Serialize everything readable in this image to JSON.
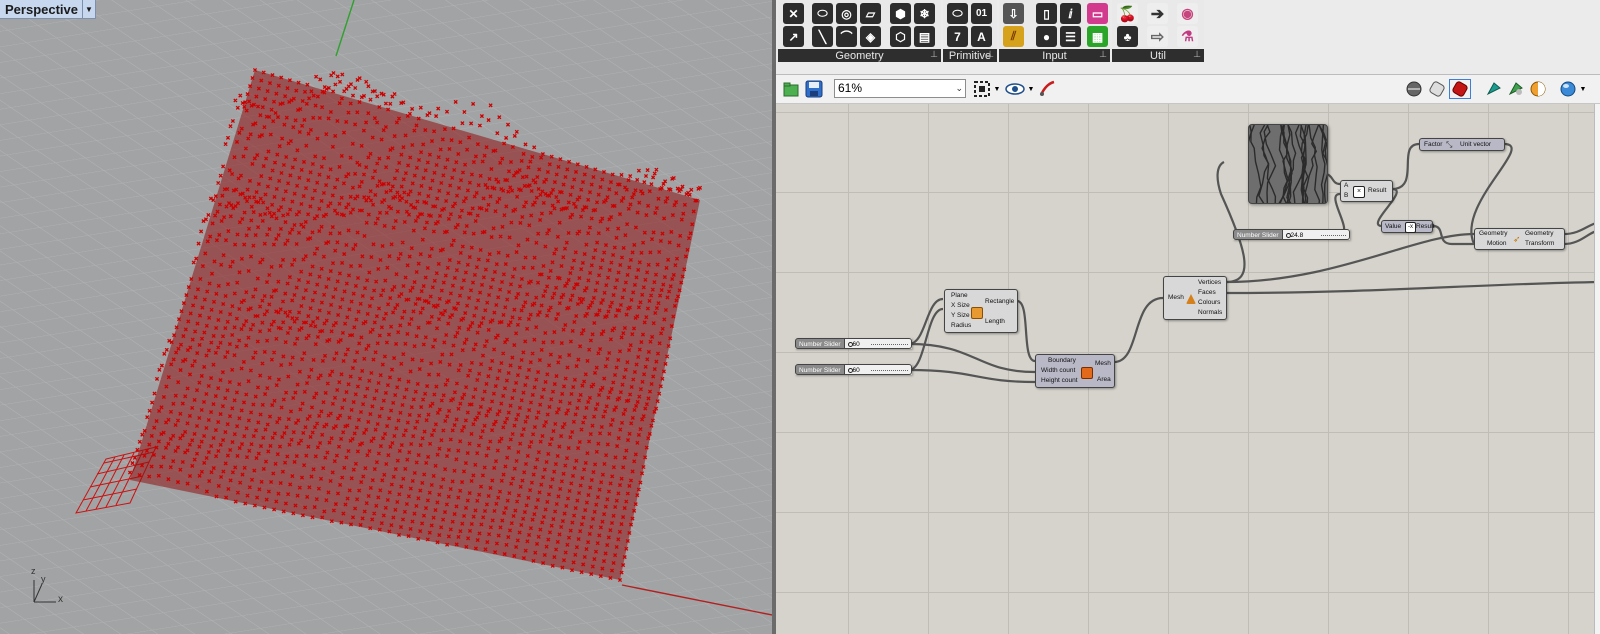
{
  "viewport": {
    "tab_label": "Perspective",
    "axis_x": "x",
    "axis_y": "y",
    "axis_z": "z"
  },
  "ribbon": {
    "panels": [
      {
        "label": "Geometry",
        "icons": [
          "point-icon",
          "circle-icon",
          "curve-icon",
          "surface-icon",
          "brep-icon",
          "mesh-icon",
          "vector-icon",
          "line-icon",
          "plane-icon",
          "twisted-box-icon",
          "field-icon",
          "geometry-pipeline-icon"
        ]
      },
      {
        "label": "Primitive",
        "icons": [
          "boolean-icon",
          "integer-icon",
          "number-icon",
          "text-icon"
        ]
      },
      {
        "label": "Input",
        "icons": [
          "data-input-icon",
          "panel-icon",
          "value-list-icon",
          "gradient-icon",
          "graph-mapper-icon",
          "toggle-icon",
          "button-icon",
          "colour-swatch-icon"
        ]
      },
      {
        "label": "Util",
        "icons": [
          "cherry-icon",
          "relay-icon",
          "data-dam-icon",
          "arrow-icon",
          "galapagos-icon",
          "flask-icon"
        ]
      }
    ]
  },
  "toolbar": {
    "zoom": "61%"
  },
  "components": {
    "rectangle": {
      "inputs": [
        "Plane",
        "X Size",
        "Y Size",
        "Radius"
      ],
      "outputs": [
        "Rectangle",
        "Length"
      ]
    },
    "mesh_plane": {
      "inputs": [
        "Boundary",
        "Width count",
        "Height count"
      ],
      "outputs": [
        "Mesh",
        "Area"
      ]
    },
    "deconstruct_mesh": {
      "inputs": [
        "Mesh"
      ],
      "outputs": [
        "Vertices",
        "Faces",
        "Colours",
        "Normals"
      ]
    },
    "multiplication": {
      "inputs": [
        "A",
        "B"
      ],
      "outputs": [
        "Result"
      ]
    },
    "negative": {
      "inputs": [
        "Value"
      ],
      "outputs": [
        "Result"
      ]
    },
    "amplitude": {
      "inputs": [
        "Factor"
      ],
      "outputs": [
        "Unit vector"
      ]
    },
    "move": {
      "inputs": [
        "Geometry",
        "Motion"
      ],
      "outputs": [
        "Geometry",
        "Transform"
      ]
    }
  },
  "sliders": [
    {
      "name": "Number Slider",
      "value": "60"
    },
    {
      "name": "Number Slider",
      "value": "60"
    },
    {
      "name": "Number Slider",
      "value": "24.8"
    }
  ],
  "colors": {
    "points": "#cc0000",
    "viewport_bg": "#a2a3a4",
    "canvas_bg": "#d5d3cb"
  }
}
